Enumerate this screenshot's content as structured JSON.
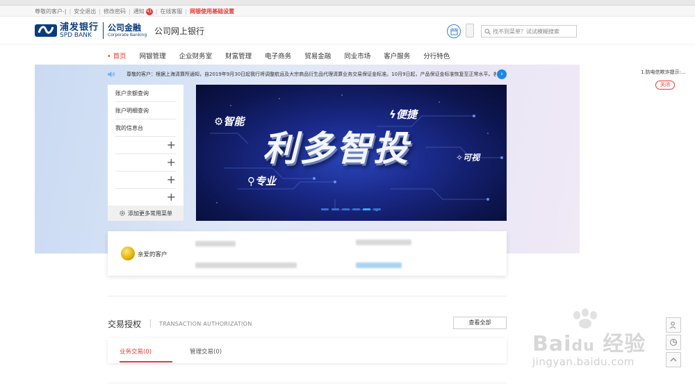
{
  "util_bar": {
    "greeting": "尊敬的客户-|",
    "logout": "安全退出",
    "change_password": "修改密码",
    "notice": "通知",
    "notice_count": "41",
    "online_service": "在线客服",
    "setup": "网银使用基础设置"
  },
  "header": {
    "bank_name_cn": "浦发银行",
    "bank_name_en": "SPD BANK",
    "corp_cn": "公司金融",
    "corp_en": "Corporate Banking",
    "site_title": "公司网上银行",
    "search_placeholder": "找不到菜单？试试模糊搜索"
  },
  "nav": {
    "items": [
      "首页",
      "网银管理",
      "企业财务室",
      "财富管理",
      "电子商务",
      "贸易金融",
      "同业市场",
      "客户服务",
      "分行特色"
    ]
  },
  "notice_bar": {
    "text": "尊敬的客户：根据上海清算所通知，自2019年9月30日起我行将调整航运及大宗商品衍生品代理清算业务交易保证金标准。10月9日起，产品保证金标准恢复至正常水平。各交"
  },
  "quick_menu": {
    "items": [
      "账户余额查询",
      "账户明细查询",
      "我的信息台"
    ],
    "add_more": "添加更多常用菜单"
  },
  "banner": {
    "headline": "利多智投",
    "tags": [
      "智能",
      "便捷",
      "可视",
      "专业"
    ]
  },
  "profile": {
    "name": "亲爱的客户"
  },
  "authorization": {
    "title": "交易授权",
    "title_en": "TRANSACTION AUTHORIZATION",
    "view_all": "查看全部",
    "tabs": [
      "业务交易(0)",
      "管理交易(0)"
    ]
  },
  "side_notice": {
    "text": "1.防电信欺诈提示:...",
    "close": "关闭"
  },
  "colors": {
    "brand_blue": "#0a3c7d",
    "accent_red": "#e53935",
    "link_blue": "#1e88e5"
  }
}
